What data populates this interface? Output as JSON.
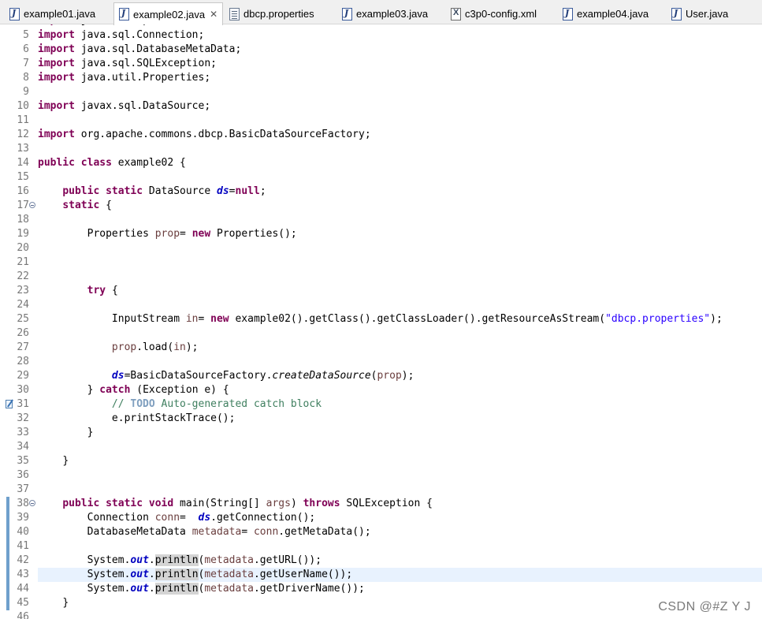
{
  "tabs": [
    {
      "label": "example01.java",
      "icon": "java-file-icon"
    },
    {
      "label": "example02.java",
      "icon": "java-file-icon",
      "active": true
    },
    {
      "label": "dbcp.properties",
      "icon": "properties-file-icon"
    },
    {
      "label": "example03.java",
      "icon": "java-file-icon"
    },
    {
      "label": "c3p0-config.xml",
      "icon": "xml-file-icon"
    },
    {
      "label": "example04.java",
      "icon": "java-file-icon"
    },
    {
      "label": "User.java",
      "icon": "java-file-icon"
    }
  ],
  "close_glyph": "✕",
  "code": {
    "partial_top_line": "import java.io.InputStream;",
    "lines": [
      {
        "n": "5"
      },
      {
        "n": "6"
      },
      {
        "n": "7"
      },
      {
        "n": "8"
      },
      {
        "n": "9"
      },
      {
        "n": "10"
      },
      {
        "n": "11"
      },
      {
        "n": "12"
      },
      {
        "n": "13"
      },
      {
        "n": "14"
      },
      {
        "n": "15"
      },
      {
        "n": "16"
      },
      {
        "n": "17"
      },
      {
        "n": "18"
      },
      {
        "n": "19"
      },
      {
        "n": "20"
      },
      {
        "n": "21"
      },
      {
        "n": "22"
      },
      {
        "n": "23"
      },
      {
        "n": "24"
      },
      {
        "n": "25"
      },
      {
        "n": "26"
      },
      {
        "n": "27"
      },
      {
        "n": "28"
      },
      {
        "n": "29"
      },
      {
        "n": "30"
      },
      {
        "n": "31"
      },
      {
        "n": "32"
      },
      {
        "n": "33"
      },
      {
        "n": "34"
      },
      {
        "n": "35"
      },
      {
        "n": "36"
      },
      {
        "n": "37"
      },
      {
        "n": "38"
      },
      {
        "n": "39"
      },
      {
        "n": "40"
      },
      {
        "n": "41"
      },
      {
        "n": "42"
      },
      {
        "n": "43"
      },
      {
        "n": "44"
      },
      {
        "n": "45"
      },
      {
        "n": "46"
      }
    ],
    "text": {
      "kw_import": "import",
      "l5": "java.sql.Connection;",
      "l6": "java.sql.DatabaseMetaData;",
      "l7": "java.sql.SQLException;",
      "l8": "java.util.Properties;",
      "l10": "javax.sql.DataSource;",
      "l12": "org.apache.commons.dbcp.BasicDataSourceFactory;",
      "kw_public": "public",
      "kw_class": "class",
      "class_name": "example02 {",
      "kw_static": "static",
      "type_datasource": "DataSource",
      "field_ds": "ds",
      "eq": "=",
      "kw_null": "null",
      "semicolon": ";",
      "brace_open": "{",
      "brace_close": "}",
      "properties_type": "Properties",
      "local_prop": "prop",
      "assign_new": "=",
      "kw_new": "new",
      "properties_ctor": "Properties();",
      "kw_try": "try",
      "inputstream_type": "InputStream",
      "local_in": "in",
      "call_chain": "example02().getClass().getClassLoader().getResourceAsStream(",
      "str_dbcp": "\"dbcp.properties\"",
      "close_paren_semi": ");",
      "prop_load": ".load(",
      "close_load": ");",
      "basic_factory": "BasicDataSourceFactory.",
      "create_ds": "createDataSource",
      "paren_open": "(",
      "kw_catch": "catch",
      "exception_decl": "(Exception e) {",
      "comment_prefix": "// ",
      "todo": "TODO",
      "comment_rest": " Auto-generated catch block",
      "print_stack": "e.printStackTrace();",
      "kw_void": "void",
      "main_sig": "main(String[] ",
      "local_args": "args",
      "close_paren": ")",
      "kw_throws": "throws",
      "sqlexception_brace": "SQLException {",
      "connection_type": "Connection",
      "local_conn": "conn",
      "get_connection": ".getConnection();",
      "dbmd_type": "DatabaseMetaData",
      "local_metadata": "metadata",
      "get_metadata": ".getMetaData();",
      "system": "System.",
      "field_out": "out",
      "println": "println",
      "get_url": ".getURL());",
      "get_username": ".getUserName());",
      "get_drivername": ".getDriverName());"
    }
  },
  "watermark": "CSDN @#Z Y J"
}
